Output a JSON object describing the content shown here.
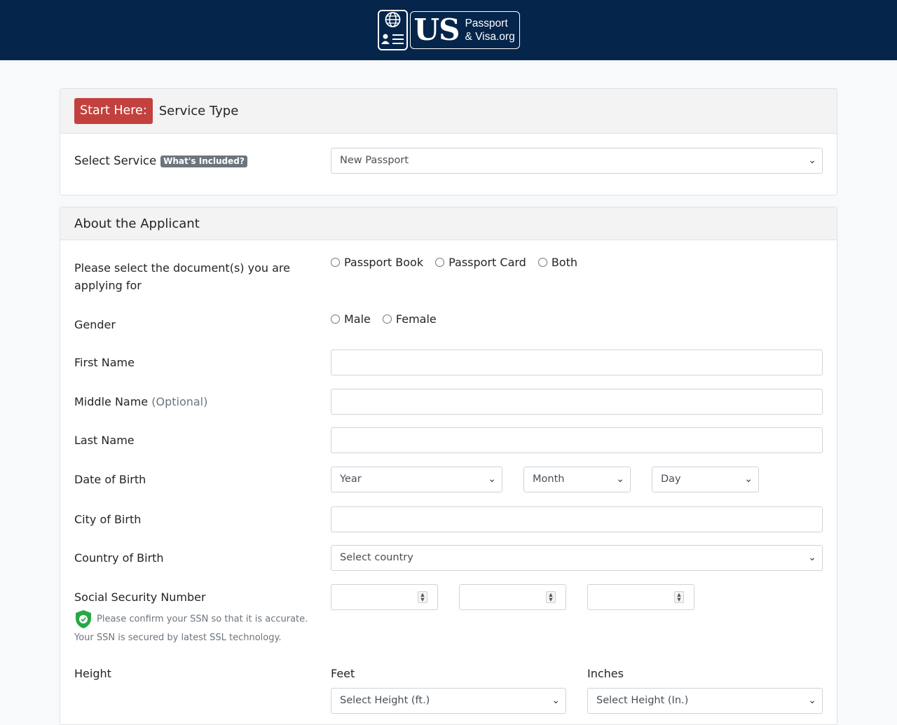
{
  "header": {
    "logo_us": "US",
    "logo_line1": "Passport",
    "logo_line2": "& Visa.org"
  },
  "service_card": {
    "start_badge": "Start Here:",
    "title": "Service Type",
    "select_service_label": "Select Service",
    "whats_included": "What's Included?",
    "service_value": "New Passport"
  },
  "applicant_card": {
    "title": "About the Applicant",
    "document_label": "Please select the document(s) you are applying for",
    "document_options": [
      "Passport Book",
      "Passport Card",
      "Both"
    ],
    "gender_label": "Gender",
    "gender_options": [
      "Male",
      "Female"
    ],
    "first_name_label": "First Name",
    "middle_name_label": "Middle Name",
    "middle_name_optional": "(Optional)",
    "last_name_label": "Last Name",
    "dob_label": "Date of Birth",
    "dob_year": "Year",
    "dob_month": "Month",
    "dob_day": "Day",
    "city_label": "City of Birth",
    "country_label": "Country of Birth",
    "country_placeholder": "Select country",
    "ssn_label": "Social Security Number",
    "ssn_note1": "Please confirm your SSN so that it is accurate.",
    "ssn_note2": "Your SSN is secured by latest SSL technology.",
    "height_label": "Height",
    "feet_label": "Feet",
    "inches_label": "Inches",
    "feet_placeholder": "Select Height (ft.)",
    "inches_placeholder": "Select Height (In.)"
  },
  "colors": {
    "topbar": "#05254b",
    "start_badge": "#c2413e",
    "pill": "#6c757d",
    "shield": "#28a745"
  }
}
